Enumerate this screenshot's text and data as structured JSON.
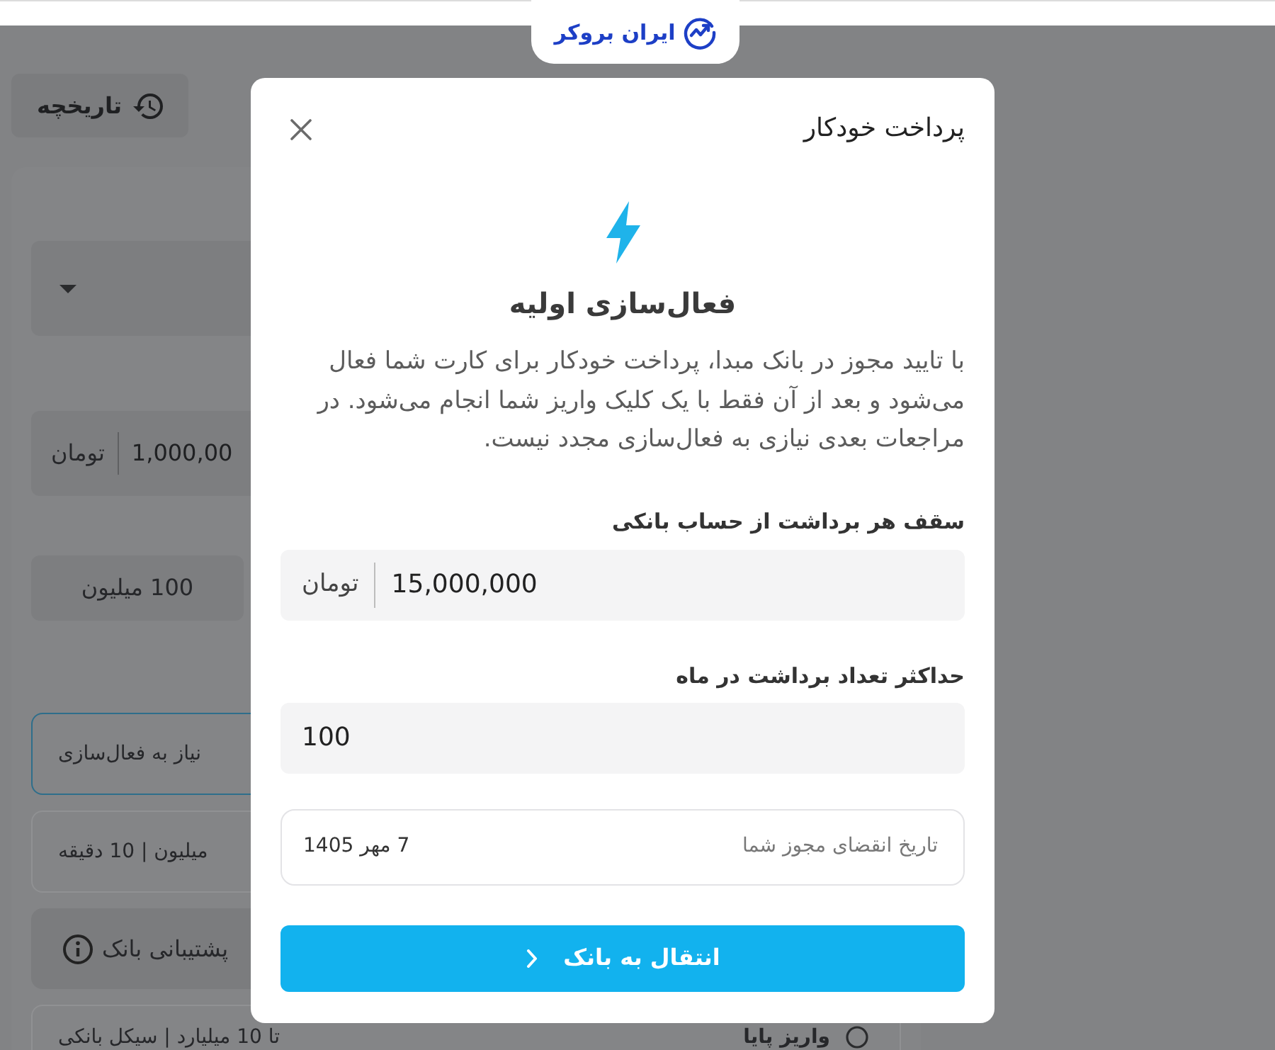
{
  "header": {
    "logo": "ایران بروکر"
  },
  "page": {
    "history_button": {
      "label": "تاریخچه"
    },
    "amount_field": {
      "value": "1,000,00",
      "unit": "تومان"
    },
    "presets": [
      {
        "label": "100 میلیون"
      }
    ],
    "methods": [
      {
        "kind": "option",
        "detail": "نیاز به فعال‌سازی",
        "selected": true
      },
      {
        "kind": "option",
        "detail": "میلیون | 10 دقیقه",
        "selected": false
      },
      {
        "kind": "notice",
        "text": "پشتیبانی بانک"
      },
      {
        "kind": "option",
        "title": "واریز پایا",
        "detail": "تا 10 میلیارد | سیکل بانکی",
        "selected": false
      }
    ]
  },
  "dialog": {
    "title": "پرداخت خودکار",
    "heading": "فعال‌سازی اولیه",
    "description": "با تایید مجوز در بانک مبدا، پرداخت خودکار برای کارت شما فعال می‌شود و بعد از آن فقط با یک کلیک واریز شما انجام می‌شود. در مراجعات بعدی نیازی به فعال‌سازی مجدد نیست.",
    "fields": [
      {
        "label": "سقف هر برداشت از حساب بانکی",
        "value": "15,000,000",
        "unit": "تومان"
      },
      {
        "label": "حداکثر تعداد برداشت در ماه",
        "value": "100"
      }
    ],
    "expiry": {
      "label": "تاریخ انقضای مجوز شما",
      "value": "7 مهر 1405"
    },
    "button": "انتقال به بانک"
  }
}
